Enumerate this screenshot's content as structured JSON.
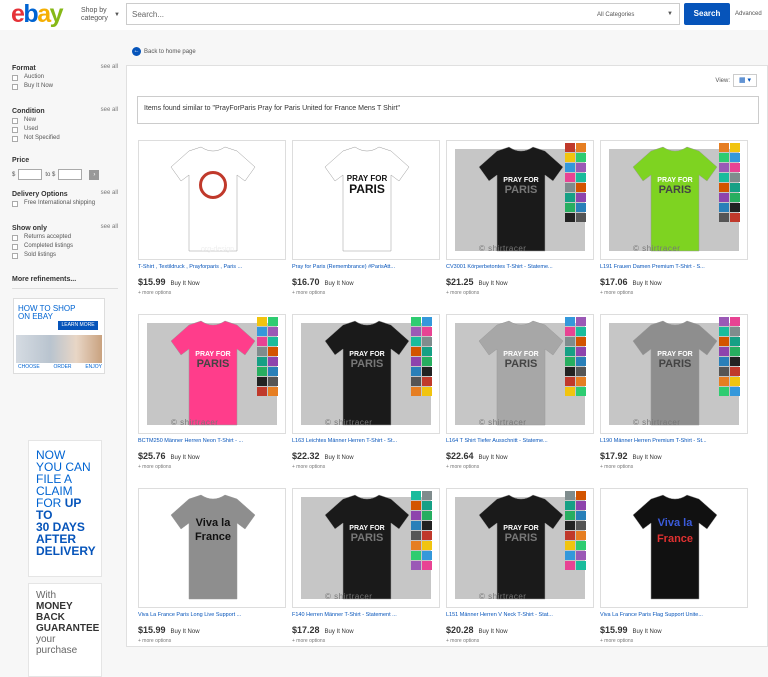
{
  "header": {
    "logo_letters": [
      "e",
      "b",
      "a",
      "y"
    ],
    "shop_by": "Shop by",
    "category": "category",
    "search_placeholder": "Search...",
    "category_select": "All Categories",
    "search_button": "Search",
    "advanced": "Advanced"
  },
  "sidebar": {
    "format": {
      "title": "Format",
      "see_all": "see all",
      "options": [
        "Auction",
        "Buy It Now"
      ]
    },
    "condition": {
      "title": "Condition",
      "see_all": "see all",
      "options": [
        "New",
        "Used",
        "Not Specified"
      ]
    },
    "price": {
      "title": "Price",
      "currency": "$",
      "to": "to $"
    },
    "delivery": {
      "title": "Delivery Options",
      "see_all": "see all",
      "options": [
        "Free International shipping"
      ]
    },
    "show_only": {
      "title": "Show only",
      "see_all": "see all",
      "options": [
        "Returns accepted",
        "Completed listings",
        "Sold listings"
      ]
    },
    "more_refinements": "More refinements...",
    "ad_how_to": {
      "title_line1": "HOW TO SHOP",
      "title_line2": "ON EBAY",
      "learn_more": "LEARN MORE",
      "steps": [
        "CHOOSE",
        "ORDER",
        "ENJOY"
      ]
    },
    "ad_claim": {
      "lines": [
        "NOW",
        "YOU CAN",
        "FILE A",
        "CLAIM",
        "FOR"
      ],
      "bold_lines": [
        "UP TO",
        "30 DAYS",
        "AFTER",
        "DELIVERY"
      ]
    },
    "ad_guarantee": {
      "line1": "With",
      "bold_lines": [
        "MONEY",
        "BACK",
        "GUARANTEE"
      ],
      "line_last": "your purchase"
    }
  },
  "main": {
    "back_link": "Back to home page",
    "view_label": "View:",
    "similar_text": "Items found similar to \"PrayForParis Pray for Paris United for France Mens T Shirt\"",
    "items": [
      {
        "title": "T-Shirt , Textildruck , Prayforparis , Paris ...",
        "price": "$15.99",
        "bin": "Buy It Now",
        "more": "+ more options",
        "shirt": "#ffffff",
        "bg": "white",
        "print": "peace",
        "wm": "org-design"
      },
      {
        "title": "Pray for Paris (Remembrance) #ParisAtt...",
        "price": "$16.70",
        "bin": "Buy It Now",
        "more": "+ more options",
        "shirt": "#ffffff",
        "bg": "white",
        "print": "pray-multi",
        "wm": ""
      },
      {
        "title": "CV3001 Körperbetontes T-Shirt - Stateme...",
        "price": "$21.25",
        "bin": "Buy It Now",
        "more": "+ more options",
        "shirt": "#1a1a1a",
        "bg": "grey",
        "print": "pray",
        "wm": "© shirtracer"
      },
      {
        "title": "L191 Frauen Damen Premium T-Shirt - S...",
        "price": "$17.06",
        "bin": "Buy It Now",
        "more": "+ more options",
        "shirt": "#7ed321",
        "bg": "grey",
        "print": "pray",
        "wm": "© shirtracer"
      },
      {
        "title": "BCTM250 Männer Herren Neon T-Shirt - ...",
        "price": "$25.76",
        "bin": "Buy It Now",
        "more": "+ more options",
        "shirt": "#ff3d8b",
        "bg": "grey",
        "print": "pray",
        "wm": "© shirtracer"
      },
      {
        "title": "L163 Leichtes Männer Herren T-Shirt - St...",
        "price": "$22.32",
        "bin": "Buy It Now",
        "more": "+ more options",
        "shirt": "#1a1a1a",
        "bg": "grey",
        "print": "pray",
        "wm": "© shirtracer"
      },
      {
        "title": "L164 T Shirt Tiefer Ausschnitt - Stateme...",
        "price": "$22.64",
        "bin": "Buy It Now",
        "more": "+ more options",
        "shirt": "#a7a7a7",
        "bg": "grey",
        "print": "pray",
        "wm": "© shirtracer"
      },
      {
        "title": "L190 Männer Herren Premium T-Shirt - St...",
        "price": "$17.92",
        "bin": "Buy It Now",
        "more": "+ more options",
        "shirt": "#8e8e8e",
        "bg": "grey",
        "print": "pray",
        "wm": "© shirtracer"
      },
      {
        "title": "Viva La France Paris Long Live Support ...",
        "price": "$15.99",
        "bin": "Buy It Now",
        "more": "+ more options",
        "shirt": "#8e8e8e",
        "bg": "white",
        "print": "viva",
        "wm": ""
      },
      {
        "title": "F140 Herren Männer T-Shirt - Statement ...",
        "price": "$17.28",
        "bin": "Buy It Now",
        "more": "+ more options",
        "shirt": "#1a1a1a",
        "bg": "grey",
        "print": "pray",
        "wm": "© shirtracer"
      },
      {
        "title": "L151 Männer Herren V Neck T-Shirt - Stat...",
        "price": "$20.28",
        "bin": "Buy It Now",
        "more": "+ more options",
        "shirt": "#1a1a1a",
        "bg": "grey",
        "print": "pray",
        "wm": "© shirtracer"
      },
      {
        "title": "Viva La France Paris Flag Support Unite...",
        "price": "$15.99",
        "bin": "Buy It Now",
        "more": "+ more options",
        "shirt": "#111111",
        "bg": "white",
        "print": "viva-flag",
        "wm": ""
      }
    ],
    "print_text": {
      "pray": "PRAY FOR",
      "paris": "PARIS",
      "viva1": "Viva la",
      "viva2": "France"
    }
  }
}
